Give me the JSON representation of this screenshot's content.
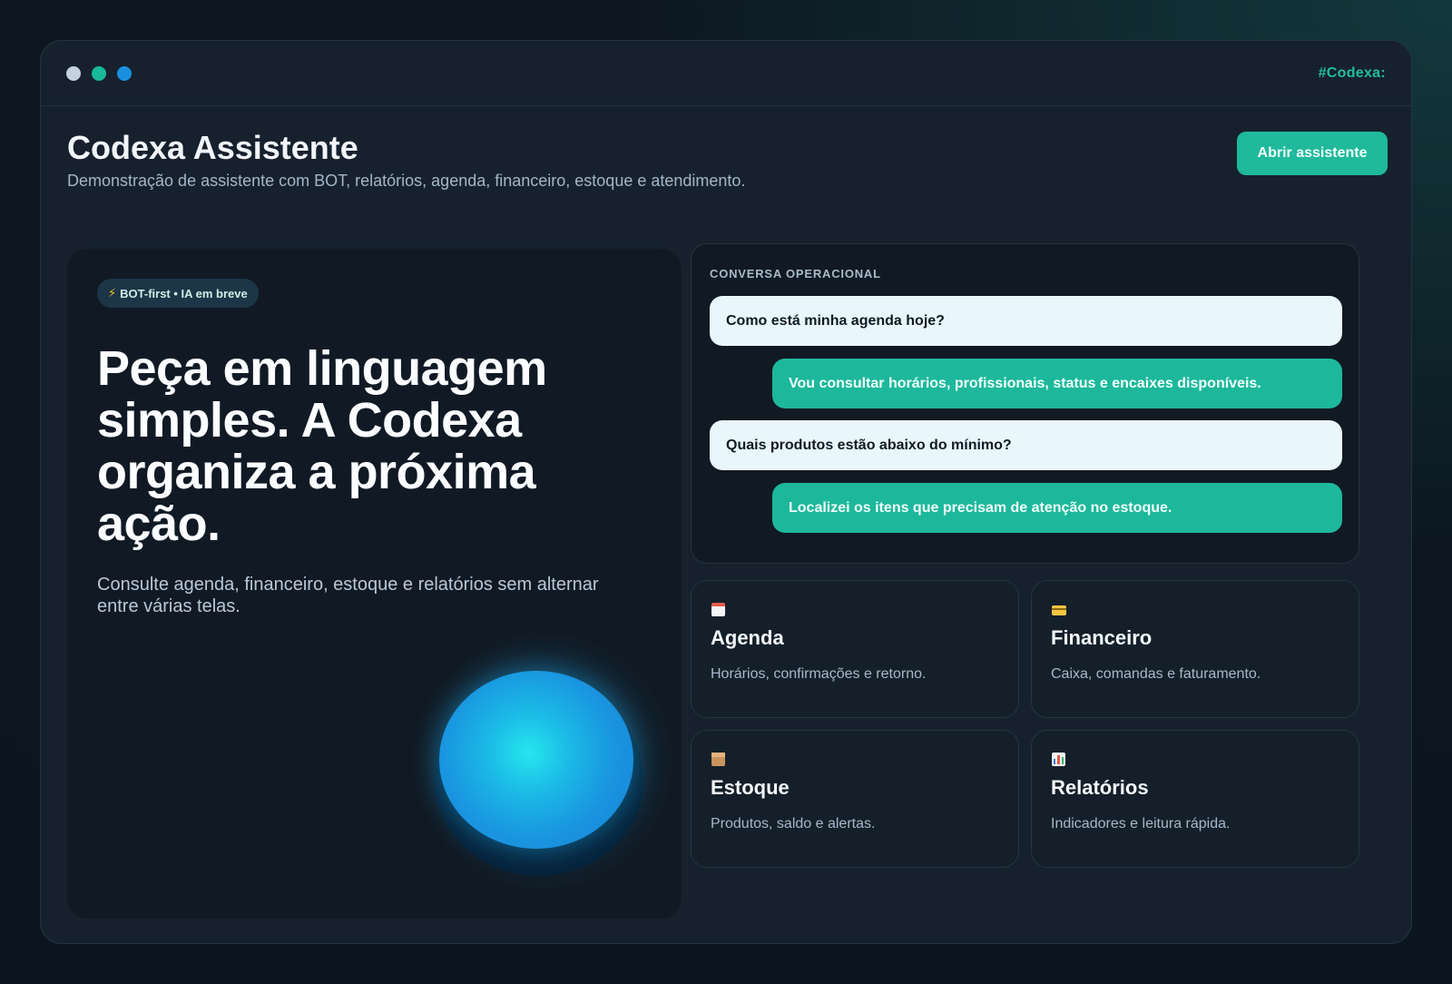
{
  "window": {
    "tag": "#Codexa:",
    "title": "Codexa Assistente",
    "subtitle": "Demonstração de assistente com BOT, relatórios, agenda, financeiro, estoque e atendimento.",
    "open_button": "Abrir assistente"
  },
  "hero": {
    "badge_icon": "⚡",
    "badge": "BOT-first • IA em breve",
    "title": "Peça em linguagem simples. A Codexa organiza a próxima ação.",
    "description": "Consulte agenda, financeiro, estoque e relatórios sem alternar entre várias telas."
  },
  "conversation": {
    "label": "CONVERSA OPERACIONAL",
    "messages": [
      {
        "role": "user",
        "text": "Como está minha agenda hoje?"
      },
      {
        "role": "bot",
        "text": "Vou consultar horários, profissionais, status e encaixes disponíveis."
      },
      {
        "role": "user",
        "text": "Quais produtos estão abaixo do mínimo?"
      },
      {
        "role": "bot",
        "text": "Localizei os itens que precisam de atenção no estoque."
      }
    ]
  },
  "cards": [
    {
      "icon": "calendar-icon",
      "title": "Agenda",
      "description": "Horários, confirmações e retorno."
    },
    {
      "icon": "credit-card-icon",
      "title": "Financeiro",
      "description": "Caixa, comandas e faturamento."
    },
    {
      "icon": "package-icon",
      "title": "Estoque",
      "description": "Produtos, saldo e alertas."
    },
    {
      "icon": "bar-chart-icon",
      "title": "Relatórios",
      "description": "Indicadores e leitura rápida."
    }
  ],
  "colors": {
    "accent": "#1fb99c",
    "background": "#0d1721",
    "window": "#16212d",
    "panel": "#111a24",
    "orb": "#1a95e0"
  }
}
